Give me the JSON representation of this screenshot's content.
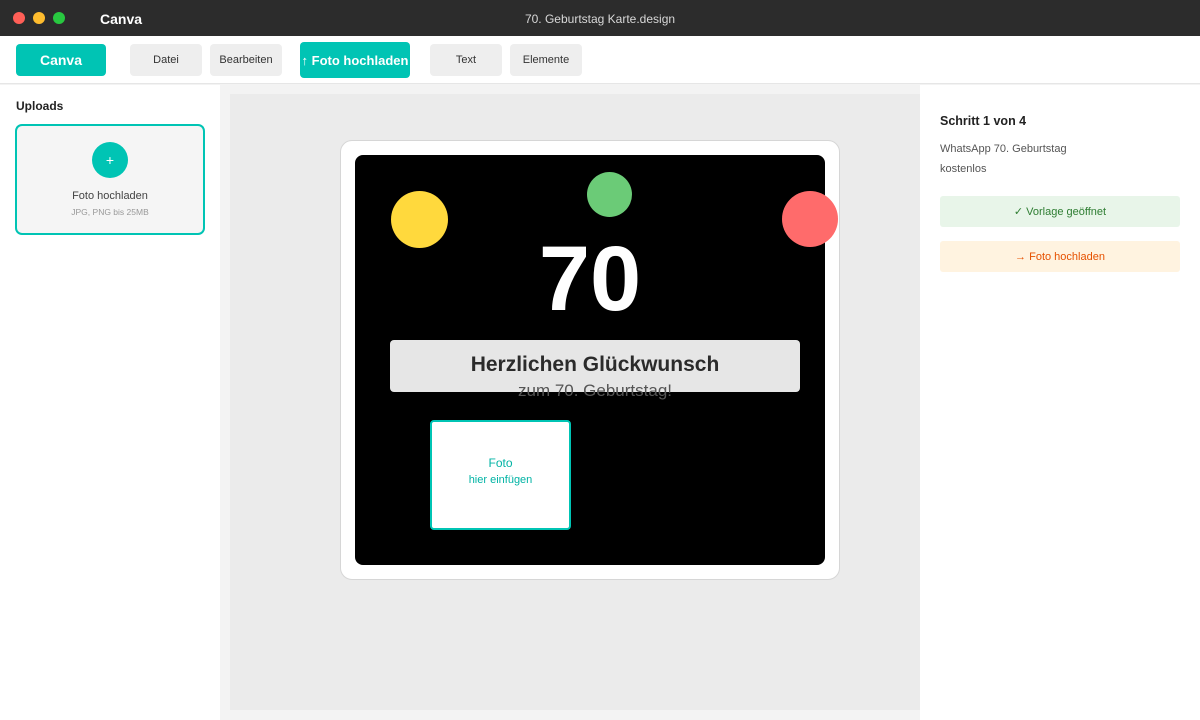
{
  "window": {
    "app_name": "Canva",
    "title": "70. Geburtstag Karte.design"
  },
  "toolbar": {
    "logo_label": "Canva",
    "file_label": "Datei",
    "edit_label": "Bearbeiten",
    "upload_label": "↑ Foto hochladen",
    "text_label": "Text",
    "elements_label": "Elemente"
  },
  "sidebar": {
    "heading": "Uploads",
    "upload_card": {
      "plus": "+",
      "label": "Foto hochladen",
      "hint": "JPG, PNG bis 25MB"
    }
  },
  "design": {
    "number": "70",
    "greeting_title": "Herzlichen Glückwunsch",
    "greeting_subtitle": "zum 70. Geburtstag!",
    "photo_placeholder_line1": "Foto",
    "photo_placeholder_line2": "hier einfügen",
    "balloon_colors": [
      "#ffd93d",
      "#6bcb77",
      "#ff6b6b"
    ]
  },
  "steps": {
    "title": "Schritt 1 von 4",
    "description_line1": "WhatsApp 70. Geburtstag",
    "description_line2": "kostenlos",
    "items": [
      {
        "label": "✓ Vorlage geöffnet",
        "state": "done"
      },
      {
        "label": "→ Foto hochladen",
        "state": "current"
      }
    ]
  },
  "colors": {
    "accent": "#00c4b4",
    "titlebar": "#2c2c2c",
    "card_background": "#000000"
  }
}
